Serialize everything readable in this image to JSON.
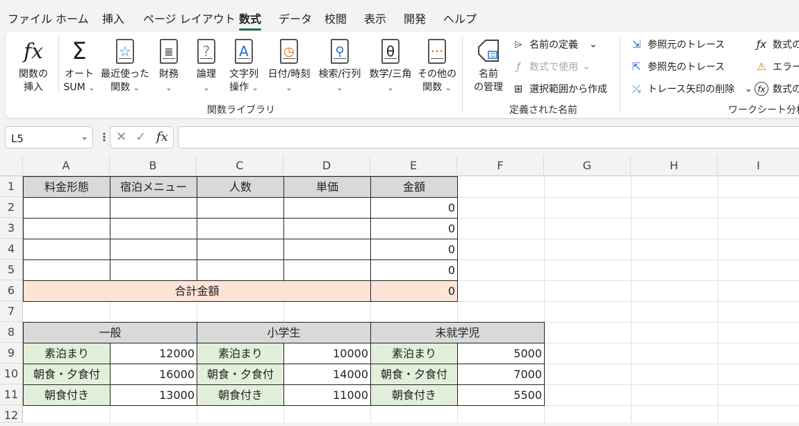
{
  "menu": {
    "tabs": [
      "ファイル",
      "ホーム",
      "挿入",
      "ページ レイアウト",
      "数式",
      "データ",
      "校閲",
      "表示",
      "開発",
      "ヘルプ"
    ],
    "active": "数式"
  },
  "ribbon": {
    "func_library": {
      "insert_function": [
        "関数の",
        "挿入"
      ],
      "autosum": [
        "オート",
        "SUM"
      ],
      "recent": [
        "最近使った",
        "関数"
      ],
      "financial": [
        "財務",
        ""
      ],
      "logical": [
        "論理",
        ""
      ],
      "text": [
        "文字列",
        "操作"
      ],
      "datetime": [
        "日付/時刻",
        ""
      ],
      "lookup": [
        "検索/行列",
        ""
      ],
      "math": [
        "数学/三角",
        ""
      ],
      "more": [
        "その他の",
        "関数"
      ],
      "group_label": "関数ライブラリ"
    },
    "defined_names": {
      "name_manager": [
        "名前",
        "の管理"
      ],
      "define_name": "名前の定義",
      "use_in_formula": "数式で使用",
      "create_from_selection": "選択範囲から作成",
      "group_label": "定義された名前"
    },
    "formula_auditing": {
      "trace_precedents": "参照元のトレース",
      "trace_dependents": "参照先のトレース",
      "remove_arrows": "トレース矢印の削除",
      "show_formulas": "数式の",
      "error_checking": "エラー",
      "evaluate_formula": "数式の",
      "group_label": "ワークシート分析"
    }
  },
  "formula_bar": {
    "name_box": "L5",
    "formula": ""
  },
  "sheet": {
    "columns": [
      "A",
      "B",
      "C",
      "D",
      "E",
      "F",
      "G",
      "H",
      "I"
    ],
    "rows": [
      "1",
      "2",
      "3",
      "4",
      "5",
      "6",
      "7",
      "8",
      "9",
      "10",
      "11",
      "12"
    ],
    "table1_headers": [
      "料金形態",
      "宿泊メニュー",
      "人数",
      "単価",
      "金額"
    ],
    "table1_amounts": [
      "0",
      "0",
      "0",
      "0"
    ],
    "total_label": "合計金額",
    "total_value": "0",
    "price_groups": [
      "一般",
      "小学生",
      "未就学児"
    ],
    "price_rows": [
      {
        "plan": "素泊まり",
        "general": "12000",
        "elementary": "10000",
        "preschool": "5000"
      },
      {
        "plan": "朝食・夕食付",
        "general": "16000",
        "elementary": "14000",
        "preschool": "7000"
      },
      {
        "plan": "朝食付き",
        "general": "13000",
        "elementary": "11000",
        "preschool": "5500"
      }
    ]
  }
}
